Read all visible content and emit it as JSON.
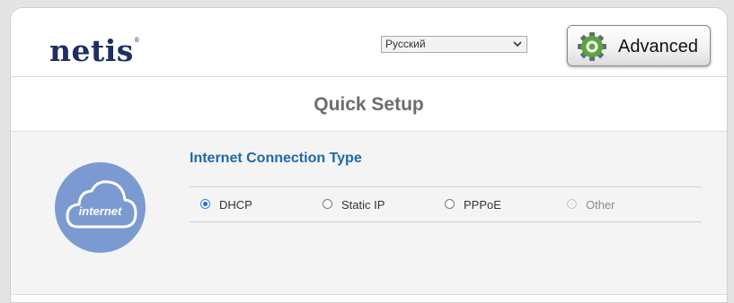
{
  "header": {
    "logo_text": "netis",
    "logo_mark": "®",
    "language": {
      "selected": "Русский"
    },
    "advanced_button": {
      "label": "Advanced",
      "icon": "gear-icon"
    }
  },
  "page": {
    "title": "Quick Setup"
  },
  "internet": {
    "icon_label": "internet",
    "section_title": "Internet Connection Type",
    "options": [
      {
        "label": "DHCP",
        "checked": true,
        "disabled": false
      },
      {
        "label": "Static IP",
        "checked": false,
        "disabled": false
      },
      {
        "label": "PPPoE",
        "checked": false,
        "disabled": false
      },
      {
        "label": "Other",
        "checked": false,
        "disabled": true
      }
    ]
  },
  "colors": {
    "brand_navy": "#1d2f63",
    "section_title_blue": "#1d68ad",
    "cloud_circle": "#7c9ad2",
    "gear_green": "#5aa63a"
  }
}
